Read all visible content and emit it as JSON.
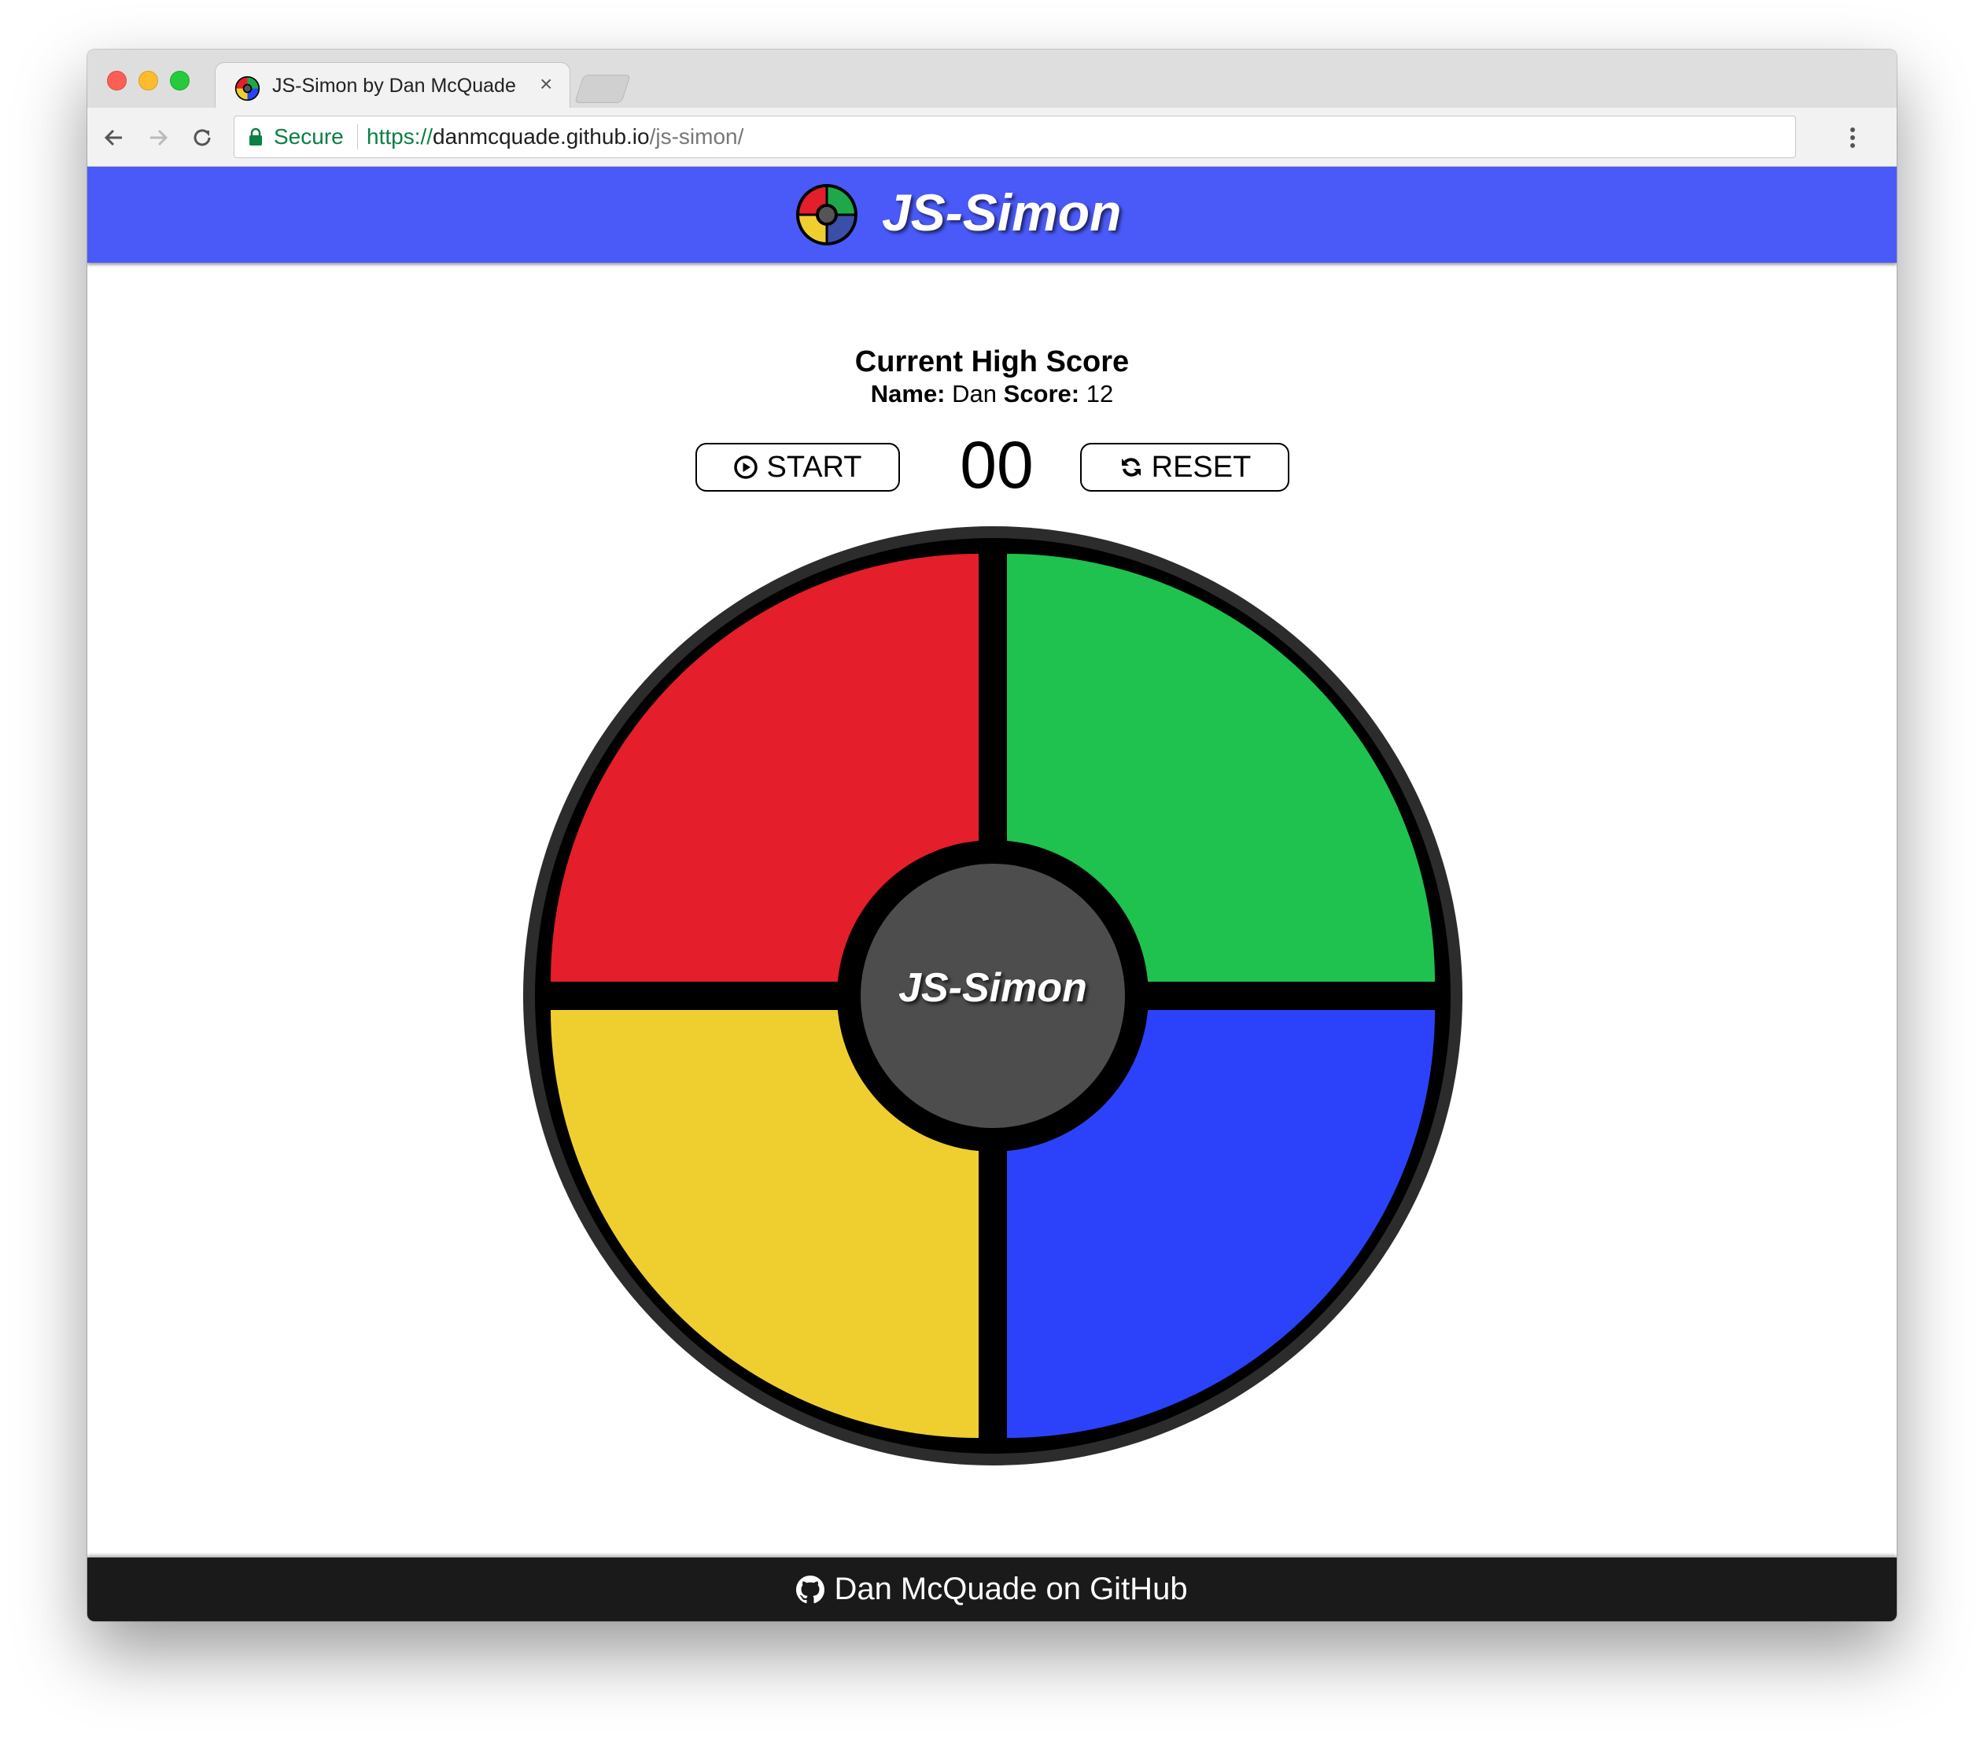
{
  "browser": {
    "tab_title": "JS-Simon by Dan McQuade",
    "tab_close_glyph": "×",
    "secure_label": "Secure",
    "url_scheme": "https://",
    "url_host": "danmcquade.github.io",
    "url_path": "/js-simon/",
    "icons": [
      "back-arrow-icon",
      "forward-arrow-icon",
      "reload-icon",
      "lock-icon",
      "kebab-menu-icon",
      "simon-favicon-icon"
    ]
  },
  "header": {
    "title": "JS-Simon",
    "color": "#4a5af8"
  },
  "high_score": {
    "title": "Current High Score",
    "name_label": "Name:",
    "name_value": "Dan",
    "score_label": "Score:",
    "score_value": "12"
  },
  "controls": {
    "start_label": "START",
    "reset_label": "RESET",
    "counter": "00",
    "icons": [
      "play-circle-icon",
      "refresh-icon"
    ]
  },
  "board": {
    "center_label": "JS-Simon",
    "pads": [
      {
        "id": "red",
        "color": "#e41e2a"
      },
      {
        "id": "green",
        "color": "#1fc24e"
      },
      {
        "id": "yellow",
        "color": "#efcf30"
      },
      {
        "id": "blue",
        "color": "#2c42fa"
      }
    ],
    "center_color": "#4d4d4d"
  },
  "footer": {
    "link_text": "Dan McQuade on GitHub",
    "icon": "github-icon"
  }
}
